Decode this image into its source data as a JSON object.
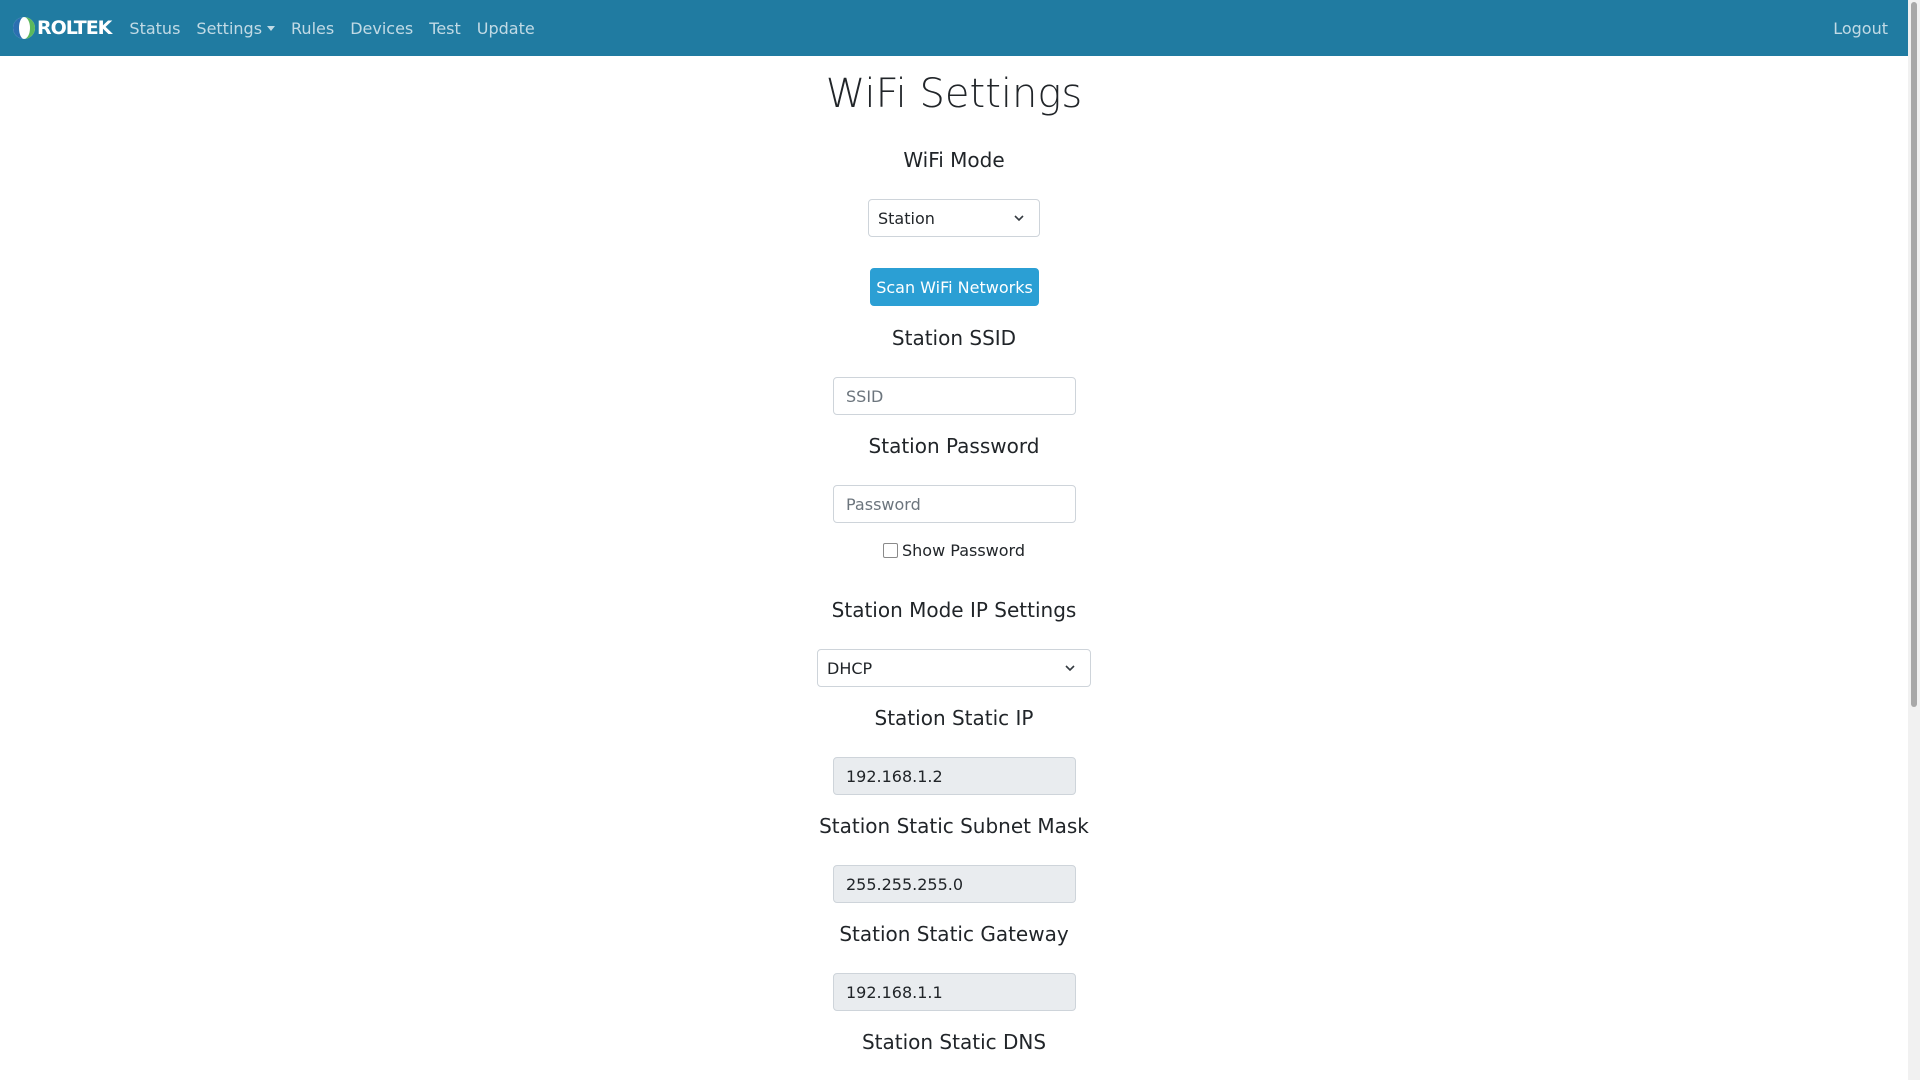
{
  "navbar": {
    "brand": "ROLTEK",
    "links": [
      {
        "label": "Status"
      },
      {
        "label": "Settings",
        "dropdown": true
      },
      {
        "label": "Rules"
      },
      {
        "label": "Devices"
      },
      {
        "label": "Test"
      },
      {
        "label": "Update"
      }
    ],
    "logout": "Logout",
    "background_color": "#207ba1"
  },
  "page": {
    "title": "WiFi Settings",
    "wifi_mode": {
      "label": "WiFi Mode",
      "selected": "Station"
    },
    "scan_button": "Scan WiFi Networks",
    "station_ssid": {
      "label": "Station SSID",
      "value": "",
      "placeholder": "SSID"
    },
    "station_password": {
      "label": "Station Password",
      "value": "",
      "placeholder": "Password"
    },
    "show_password": {
      "label": "Show Password",
      "checked": false
    },
    "ip_settings": {
      "label": "Station Mode IP Settings",
      "selected": "DHCP"
    },
    "static_ip": {
      "label": "Station Static IP",
      "value": "192.168.1.2"
    },
    "subnet_mask": {
      "label": "Station Static Subnet Mask",
      "value": "255.255.255.0"
    },
    "gateway": {
      "label": "Station Static Gateway",
      "value": "192.168.1.1"
    },
    "dns": {
      "label": "Station Static DNS"
    }
  },
  "colors": {
    "primary_button": "#2b9fd4",
    "disabled_input": "#e9ecef"
  }
}
